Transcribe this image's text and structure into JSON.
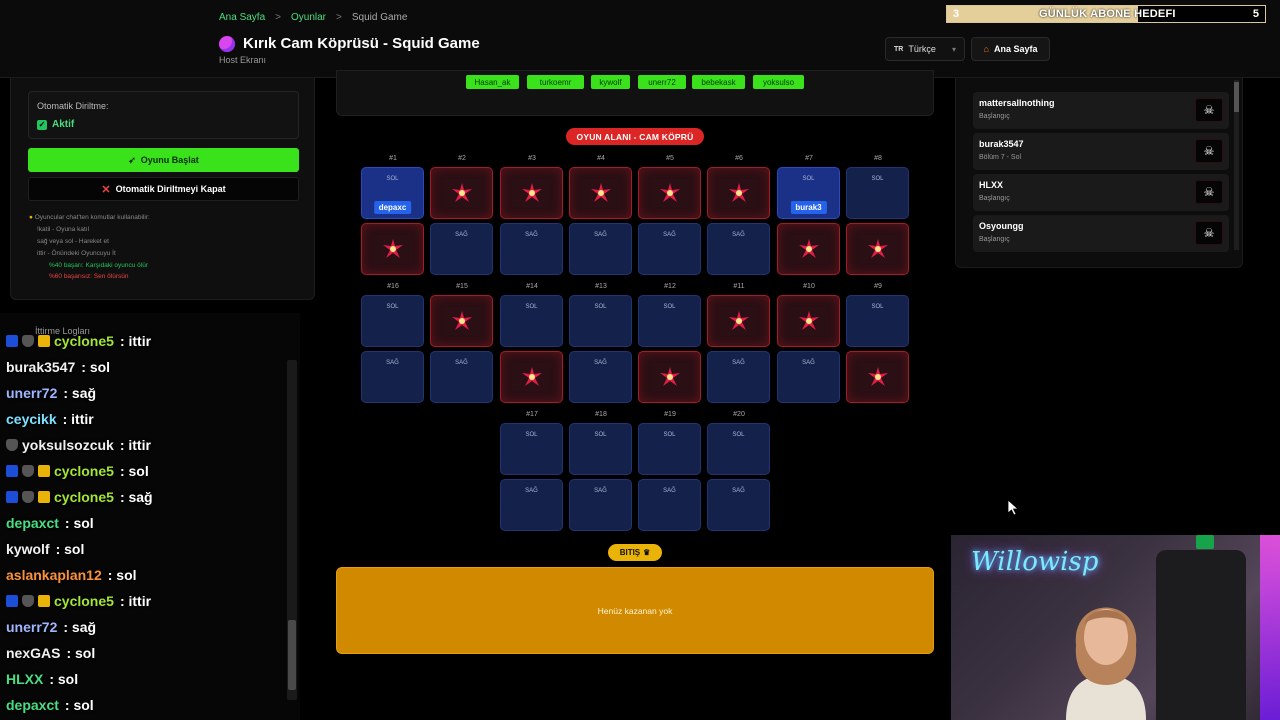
{
  "header": {
    "breadcrumb": {
      "home": "Ana Sayfa",
      "games": "Oyunlar",
      "current": "Squid Game",
      "sep": ">"
    },
    "title": "Kırık Cam Köprüsü - Squid Game",
    "subtitle": "Host Ekranı",
    "language": {
      "flag": "TR",
      "label": "Türkçe"
    },
    "home_button": "Ana Sayfa"
  },
  "subscriber_goal": {
    "current": "3",
    "label": "GÜNLÜK ABONE HEDEFI",
    "target": "5",
    "progress": 0.6
  },
  "left_panel": {
    "revive_label": "Otomatik Diriltme:",
    "revive_value": "Aktif",
    "start_button": "Oyunu Başlat",
    "close_revive_button": "Otomatik Diriltmeyi Kapat",
    "help": {
      "title": "Oyuncular chat'ten komutlar kullanabilir:",
      "lines": [
        "!katil - Oyuna katıl",
        "sağ veya sol - Hareket et",
        "ittir - Önündeki Oyuncuyu İt"
      ],
      "success": "%40 başarı: Karşıdaki oyuncu ölür",
      "fail": "%60 başarısız: Sen ölürsün"
    }
  },
  "chat": {
    "title": "İttirme Logları",
    "messages": [
      {
        "user": "cyclone5",
        "text": ": ittir",
        "color": "u-lime",
        "badges": [
          "b-blue",
          "b-shield",
          "b-gold"
        ]
      },
      {
        "user": "burak3547",
        "text": ": sol",
        "color": "u-gray",
        "badges": []
      },
      {
        "user": "unerr72",
        "text": ": sağ",
        "color": "u-blue",
        "badges": []
      },
      {
        "user": "ceycikk",
        "text": ": ittir",
        "color": "u-cyan",
        "badges": []
      },
      {
        "user": "yoksulsozcuk",
        "text": ": ittir",
        "color": "u-gray",
        "badges": [
          "b-shield"
        ]
      },
      {
        "user": "cyclone5",
        "text": ": sol",
        "color": "u-lime",
        "badges": [
          "b-blue",
          "b-shield",
          "b-gold"
        ]
      },
      {
        "user": "cyclone5",
        "text": ": sağ",
        "color": "u-lime",
        "badges": [
          "b-blue",
          "b-shield",
          "b-gold"
        ]
      },
      {
        "user": "depaxct",
        "text": ": sol",
        "color": "u-green",
        "badges": []
      },
      {
        "user": "kywolf",
        "text": ": sol",
        "color": "u-gray",
        "badges": []
      },
      {
        "user": "aslankaplan12",
        "text": ": sol",
        "color": "u-orange",
        "badges": []
      },
      {
        "user": "cyclone5",
        "text": ": ittir",
        "color": "u-lime",
        "badges": [
          "b-blue",
          "b-shield",
          "b-gold"
        ]
      },
      {
        "user": "unerr72",
        "text": ": sağ",
        "color": "u-blue",
        "badges": []
      },
      {
        "user": "nexGAS",
        "text": ": sol",
        "color": "u-gray",
        "badges": []
      },
      {
        "user": "HLXX",
        "text": ": sol",
        "color": "u-green",
        "badges": []
      },
      {
        "user": "depaxct",
        "text": ": sol",
        "color": "u-green",
        "badges": []
      }
    ]
  },
  "queue_chips": [
    "Hasan_ak",
    "turkoemr",
    "kywolf",
    "unerr72",
    "bebekask",
    "yoksulso"
  ],
  "game_area": {
    "title": "OYUN ALANI - CAM KÖPRÜ",
    "label_left": "SOL",
    "label_right": "SAĞ",
    "cells": [
      {
        "no": "#1",
        "top": "occupied",
        "bottom": "broken",
        "player": "depaxc"
      },
      {
        "no": "#2",
        "top": "broken",
        "bottom": "safe"
      },
      {
        "no": "#3",
        "top": "broken",
        "bottom": "safe"
      },
      {
        "no": "#4",
        "top": "broken",
        "bottom": "safe"
      },
      {
        "no": "#5",
        "top": "broken",
        "bottom": "safe"
      },
      {
        "no": "#6",
        "top": "broken",
        "bottom": "safe"
      },
      {
        "no": "#7",
        "top": "occupied",
        "bottom": "broken",
        "player": "burak3"
      },
      {
        "no": "#8",
        "top": "safe",
        "bottom": "broken"
      },
      {
        "no": "#16",
        "top": "safe",
        "bottom": "safe"
      },
      {
        "no": "#15",
        "top": "broken",
        "bottom": "safe"
      },
      {
        "no": "#14",
        "top": "safe",
        "bottom": "broken"
      },
      {
        "no": "#13",
        "top": "safe",
        "bottom": "safe"
      },
      {
        "no": "#12",
        "top": "safe",
        "bottom": "broken"
      },
      {
        "no": "#11",
        "top": "broken",
        "bottom": "safe"
      },
      {
        "no": "#10",
        "top": "broken",
        "bottom": "safe"
      },
      {
        "no": "#9",
        "top": "safe",
        "bottom": "broken"
      },
      {
        "no": "#17",
        "top": "safe",
        "bottom": "safe"
      },
      {
        "no": "#18",
        "top": "safe",
        "bottom": "safe"
      },
      {
        "no": "#19",
        "top": "safe",
        "bottom": "safe"
      },
      {
        "no": "#20",
        "top": "safe",
        "bottom": "safe"
      }
    ],
    "finish_label": "BITIŞ",
    "winner_text": "Henüz kazanan yok"
  },
  "players": [
    {
      "name": "mattersallnothing",
      "status": "Başlangıç"
    },
    {
      "name": "burak3547",
      "status": "Bölüm 7 - Sol"
    },
    {
      "name": "HLXX",
      "status": "Başlangıç"
    },
    {
      "name": "Osyoungg",
      "status": "Başlangıç"
    }
  ],
  "webcam": {
    "neon_sign": "Willowisp"
  },
  "colors": {
    "accent": "#39e21a",
    "danger": "#dc2626",
    "gold": "#d18a00",
    "tile_safe": "#14214a",
    "tile_broken": "#2a0f14"
  }
}
